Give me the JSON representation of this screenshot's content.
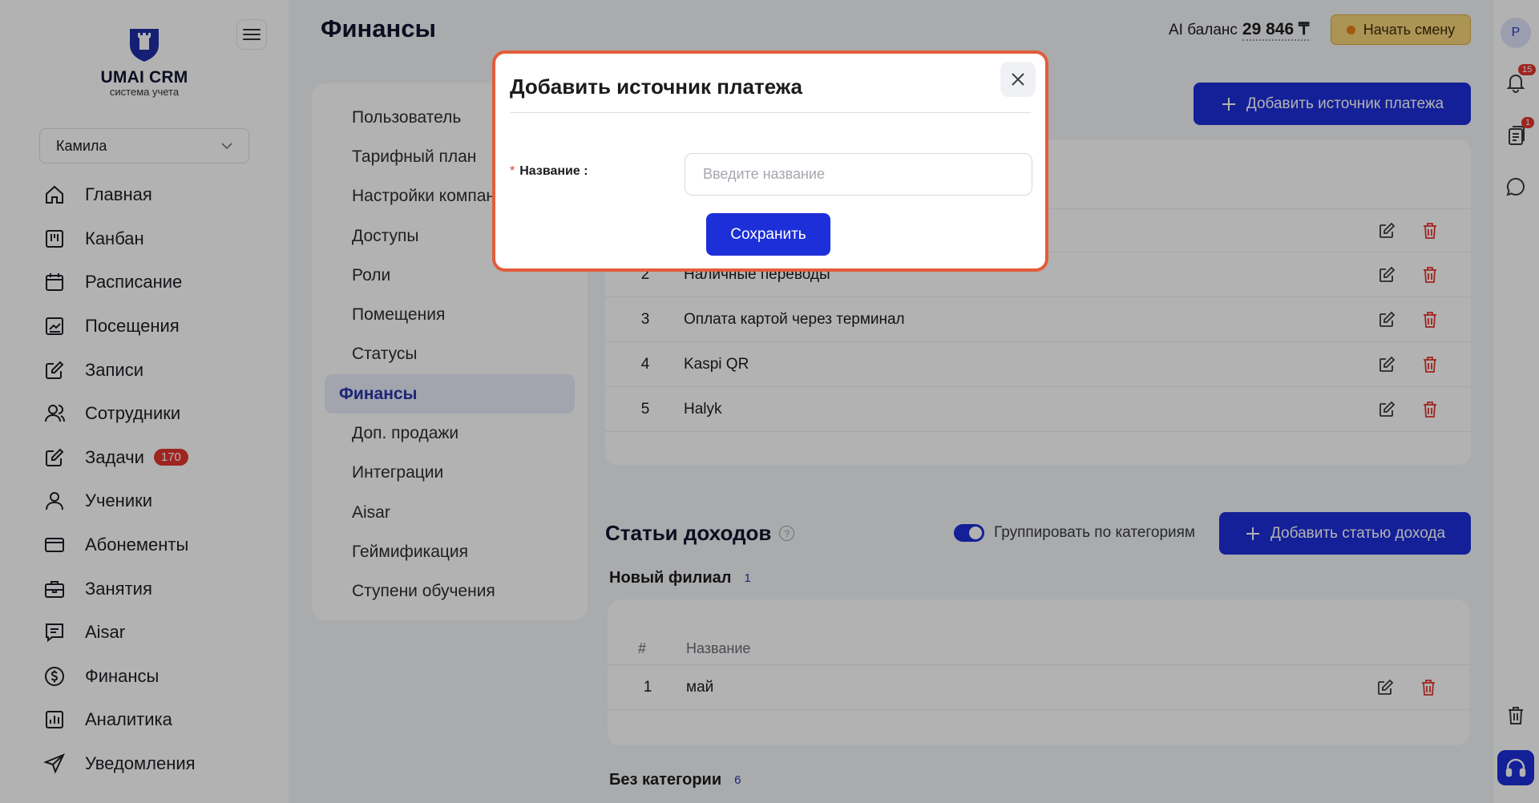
{
  "brand": {
    "name": "UMAI CRM",
    "tagline": "система учета"
  },
  "branch": {
    "selected": "Камила"
  },
  "nav": [
    {
      "label": "Главная",
      "icon": "home-icon"
    },
    {
      "label": "Канбан",
      "icon": "kanban-icon"
    },
    {
      "label": "Расписание",
      "icon": "calendar-icon"
    },
    {
      "label": "Посещения",
      "icon": "chart-icon"
    },
    {
      "label": "Записи",
      "icon": "edit-icon"
    },
    {
      "label": "Сотрудники",
      "icon": "users-icon"
    },
    {
      "label": "Задачи",
      "icon": "tasks-icon",
      "badge": "170"
    },
    {
      "label": "Ученики",
      "icon": "user-icon"
    },
    {
      "label": "Абонементы",
      "icon": "card-icon"
    },
    {
      "label": "Занятия",
      "icon": "briefcase-icon"
    },
    {
      "label": "Aisar",
      "icon": "message-icon"
    },
    {
      "label": "Финансы",
      "icon": "dollar-icon"
    },
    {
      "label": "Аналитика",
      "icon": "analytics-icon"
    },
    {
      "label": "Уведомления",
      "icon": "send-icon"
    }
  ],
  "header": {
    "title": "Финансы",
    "ai_label": "AI баланс",
    "ai_amount": "29 846 ₸",
    "shift_button": "Начать смену"
  },
  "rail": {
    "avatar": "P",
    "notifications_badge": "15",
    "docs_badge": "1"
  },
  "submenu": [
    "Пользователь",
    "Тарифный план",
    "Настройки компании",
    "Доступы",
    "Роли",
    "Помещения",
    "Статусы",
    "Финансы",
    "Доп. продажи",
    "Интеграции",
    "Aisar",
    "Геймификация",
    "Ступени обучения"
  ],
  "submenu_active": "Финансы",
  "payment_sources": {
    "add_button": "Добавить источник платежа",
    "rows": [
      {
        "num": "2",
        "name": "Наличные переводы"
      },
      {
        "num": "3",
        "name": "Оплата картой через терминал"
      },
      {
        "num": "4",
        "name": "Kaspi QR"
      },
      {
        "num": "5",
        "name": "Halyk"
      }
    ]
  },
  "income": {
    "title": "Статьи доходов",
    "toggle_label": "Группировать по категориям",
    "toggle_on": true,
    "add_button": "Добавить статью дохода",
    "group1": {
      "label": "Новый филиал",
      "count": "1"
    },
    "columns": {
      "num": "#",
      "name": "Название"
    },
    "rows": [
      {
        "num": "1",
        "name": "май"
      }
    ],
    "group2": {
      "label": "Без категории",
      "count": "6"
    }
  },
  "modal": {
    "title": "Добавить источник платежа",
    "field_label": "Название :",
    "required_mark": "*",
    "placeholder": "Введите название",
    "value": "",
    "save_button": "Сохранить"
  },
  "colors": {
    "primary": "#1c2fd8",
    "danger": "#e2362f",
    "modal_border": "#e25d3b",
    "shift": "#f6d47a"
  }
}
